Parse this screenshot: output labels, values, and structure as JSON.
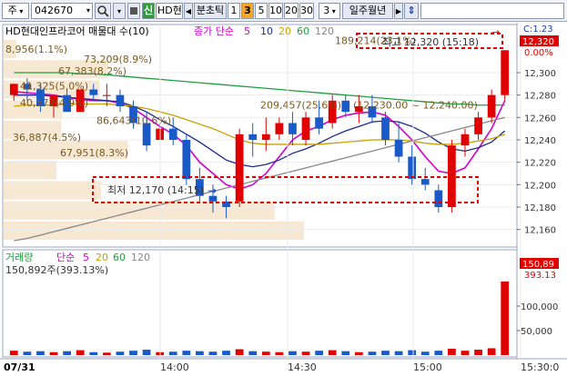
{
  "toolbar": {
    "market": "주",
    "code": "042670",
    "signal_label": "신",
    "name_short": "HD현",
    "interval_label": "분초틱",
    "intervals": [
      "1",
      "3",
      "5",
      "10",
      "20",
      "30"
    ],
    "selected_interval": "3",
    "period_value": "3",
    "range_label": "일주월년"
  },
  "main_panel": {
    "title": "HD현대인프라코어 매물대 수(10)",
    "ma_label": "종가 단순",
    "ma_periods": [
      "5",
      "10",
      "20",
      "60",
      "120"
    ],
    "ma_colors": [
      "#d000d0",
      "#1a2a90",
      "#c8a000",
      "#1e9e3e",
      "#888888"
    ],
    "current_label": "C:1.23",
    "current_price": "12,320",
    "change_pct": "0.00%",
    "high_note": "최고 12,320 (15:18)",
    "low_note": "최저 12,170 (14:15)",
    "volume_profile": [
      {
        "label": "8,956(1.1%)"
      },
      {
        "label": "73,209(8.9%)"
      },
      {
        "label": "67,383(8.2%)"
      },
      {
        "label": "41,325(5.0%)"
      },
      {
        "label": "40,572(4.9%)"
      },
      {
        "label": "86,643(10.6%)"
      },
      {
        "label": "36,887(4.5%)"
      },
      {
        "label": "67,951(8.3%)"
      },
      {
        "label": "189,214(23.1%)"
      },
      {
        "label": "209,457(25.6%)"
      }
    ],
    "inline_note": "(12,230.00 ~ 12,240.00)",
    "y_ticks": [
      "12,300",
      "12,280",
      "12,260",
      "12,240",
      "12,220",
      "12,200",
      "12,180",
      "12,160"
    ]
  },
  "volume_panel": {
    "title": "거래량",
    "ma_label": "단순",
    "ma_periods": [
      "5",
      "20",
      "60",
      "120"
    ],
    "value_note": "150,892주(393.13%)",
    "current_volume": "150,89",
    "current_ratio": "393.13",
    "y_ticks": [
      "100,000",
      "50,000"
    ]
  },
  "x_axis": {
    "date_label": "07/31",
    "ticks": [
      "14:00",
      "14:30",
      "15:00",
      "15:30:0"
    ]
  },
  "chart_data": {
    "type": "candlestick",
    "time_axis": [
      "13:30",
      "15:30"
    ],
    "interval_minutes": 3,
    "ylim": [
      12150,
      12330
    ],
    "candles": [
      {
        "o": 12280,
        "h": 12290,
        "l": 12275,
        "c": 12290
      },
      {
        "o": 12290,
        "h": 12295,
        "l": 12275,
        "c": 12285
      },
      {
        "o": 12285,
        "h": 12290,
        "l": 12265,
        "c": 12270
      },
      {
        "o": 12270,
        "h": 12280,
        "l": 12260,
        "c": 12280
      },
      {
        "o": 12280,
        "h": 12285,
        "l": 12265,
        "c": 12265
      },
      {
        "o": 12265,
        "h": 12285,
        "l": 12265,
        "c": 12285
      },
      {
        "o": 12285,
        "h": 12290,
        "l": 12275,
        "c": 12280
      },
      {
        "o": 12280,
        "h": 12290,
        "l": 12270,
        "c": 12280
      },
      {
        "o": 12280,
        "h": 12285,
        "l": 12265,
        "c": 12270
      },
      {
        "o": 12270,
        "h": 12275,
        "l": 12250,
        "c": 12255
      },
      {
        "o": 12255,
        "h": 12265,
        "l": 12230,
        "c": 12235
      },
      {
        "o": 12240,
        "h": 12255,
        "l": 12240,
        "c": 12250
      },
      {
        "o": 12250,
        "h": 12260,
        "l": 12235,
        "c": 12240
      },
      {
        "o": 12240,
        "h": 12245,
        "l": 12200,
        "c": 12205
      },
      {
        "o": 12205,
        "h": 12215,
        "l": 12185,
        "c": 12190
      },
      {
        "o": 12190,
        "h": 12200,
        "l": 12175,
        "c": 12185
      },
      {
        "o": 12185,
        "h": 12190,
        "l": 12170,
        "c": 12180
      },
      {
        "o": 12185,
        "h": 12250,
        "l": 12180,
        "c": 12245
      },
      {
        "o": 12245,
        "h": 12255,
        "l": 12225,
        "c": 12240
      },
      {
        "o": 12240,
        "h": 12260,
        "l": 12230,
        "c": 12245
      },
      {
        "o": 12245,
        "h": 12260,
        "l": 12240,
        "c": 12255
      },
      {
        "o": 12255,
        "h": 12265,
        "l": 12235,
        "c": 12245
      },
      {
        "o": 12240,
        "h": 12265,
        "l": 12235,
        "c": 12260
      },
      {
        "o": 12260,
        "h": 12275,
        "l": 12245,
        "c": 12250
      },
      {
        "o": 12255,
        "h": 12280,
        "l": 12250,
        "c": 12275
      },
      {
        "o": 12275,
        "h": 12280,
        "l": 12260,
        "c": 12265
      },
      {
        "o": 12265,
        "h": 12280,
        "l": 12255,
        "c": 12270
      },
      {
        "o": 12270,
        "h": 12280,
        "l": 12255,
        "c": 12260
      },
      {
        "o": 12260,
        "h": 12265,
        "l": 12235,
        "c": 12240
      },
      {
        "o": 12240,
        "h": 12255,
        "l": 12220,
        "c": 12225
      },
      {
        "o": 12225,
        "h": 12235,
        "l": 12200,
        "c": 12205
      },
      {
        "o": 12205,
        "h": 12215,
        "l": 12195,
        "c": 12200
      },
      {
        "o": 12195,
        "h": 12200,
        "l": 12175,
        "c": 12180
      },
      {
        "o": 12180,
        "h": 12240,
        "l": 12175,
        "c": 12235
      },
      {
        "o": 12235,
        "h": 12250,
        "l": 12225,
        "c": 12245
      },
      {
        "o": 12245,
        "h": 12265,
        "l": 12240,
        "c": 12260
      },
      {
        "o": 12260,
        "h": 12285,
        "l": 12255,
        "c": 12280
      },
      {
        "o": 12280,
        "h": 12320,
        "l": 12275,
        "c": 12320
      }
    ],
    "volumes": [
      9000,
      7000,
      8000,
      6000,
      8000,
      10000,
      6000,
      5000,
      7000,
      9000,
      11000,
      6000,
      7000,
      9000,
      8000,
      7000,
      9000,
      12000,
      8000,
      7000,
      6000,
      8000,
      7000,
      9000,
      10000,
      8000,
      6000,
      7000,
      9000,
      8000,
      10000,
      7000,
      9000,
      13000,
      9000,
      11000,
      14000,
      150892
    ],
    "ma_lines": [
      {
        "name": "5",
        "values": [
          12283,
          12282,
          12281,
          12280,
          12278,
          12276,
          12275,
          12275,
          12273,
          12268,
          12260,
          12252,
          12245,
          12235,
          12220,
          12210,
          12200,
          12196,
          12200,
          12210,
          12225,
          12240,
          12248,
          12252,
          12258,
          12262,
          12264,
          12265,
          12262,
          12252,
          12240,
          12225,
          12212,
          12210,
          12215,
          12232,
          12250,
          12275
        ]
      },
      {
        "name": "10",
        "values": [
          12280,
          12280,
          12280,
          12279,
          12278,
          12277,
          12276,
          12275,
          12274,
          12270,
          12265,
          12258,
          12252,
          12245,
          12238,
          12230,
          12222,
          12218,
          12216,
          12218,
          12222,
          12228,
          12232,
          12237,
          12243,
          12248,
          12252,
          12256,
          12257,
          12256,
          12252,
          12246,
          12238,
          12232,
          12230,
          12233,
          12238,
          12248
        ]
      },
      {
        "name": "20",
        "values": [
          12270,
          12271,
          12271,
          12271,
          12272,
          12272,
          12272,
          12272,
          12271,
          12270,
          12268,
          12265,
          12262,
          12258,
          12254,
          12250,
          12245,
          12240,
          12237,
          12236,
          12236,
          12236,
          12236,
          12236,
          12237,
          12238,
          12239,
          12240,
          12240,
          12240,
          12239,
          12237,
          12236,
          12236,
          12237,
          12239,
          12241,
          12245
        ]
      },
      {
        "name": "60",
        "values": [
          12300,
          12300,
          12300,
          12300,
          12300,
          12299,
          12299,
          12298,
          12297,
          12296,
          12295,
          12294,
          12293,
          12292,
          12291,
          12290,
          12289,
          12288,
          12287,
          12286,
          12285,
          12284,
          12283,
          12282,
          12281,
          12280,
          12279,
          12278,
          12277,
          12276,
          12275,
          12274,
          12273,
          12272,
          12272,
          12271,
          12271,
          12271
        ]
      },
      {
        "name": "120",
        "values": [
          12150,
          12152,
          12155,
          12158,
          12161,
          12164,
          12167,
          12170,
          12173,
          12176,
          12179,
          12182,
          12185,
          12188,
          12191,
          12194,
          12197,
          12200,
          12203,
          12206,
          12209,
          12212,
          12215,
          12218,
          12221,
          12224,
          12227,
          12230,
          12233,
          12236,
          12239,
          12242,
          12245,
          12248,
          12251,
          12254,
          12257,
          12260
        ]
      }
    ]
  }
}
